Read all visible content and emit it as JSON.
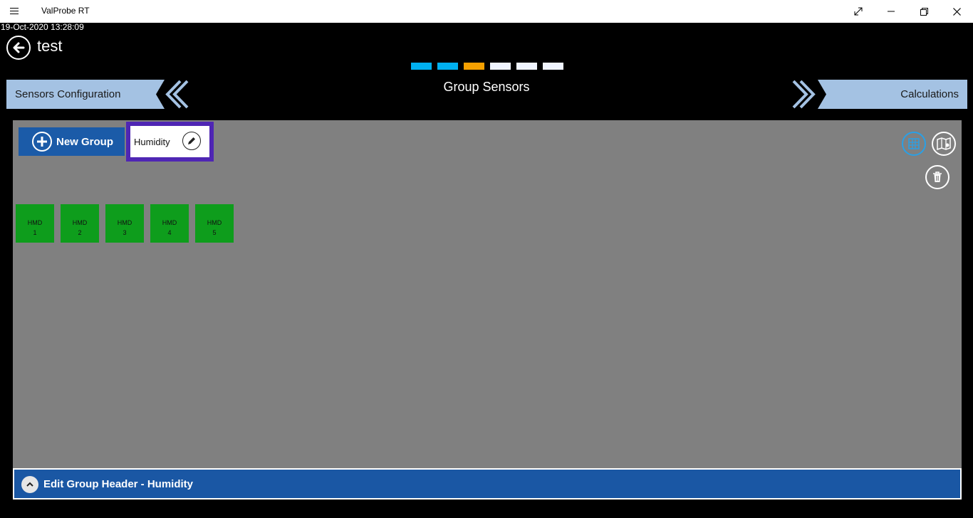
{
  "window": {
    "app_title": "ValProbe RT",
    "menu_icon": "hamburger-icon",
    "controls": [
      "expand-icon",
      "minimize-icon",
      "restore-icon",
      "close-icon"
    ]
  },
  "header": {
    "timestamp": "19-Oct-2020 13:28:09",
    "title": "test"
  },
  "wizard": {
    "steps": [
      {
        "color": "#00b0f0",
        "state": "done"
      },
      {
        "color": "#00b0f0",
        "state": "done"
      },
      {
        "color": "#f5a000",
        "state": "current"
      },
      {
        "color": "#f0f4ff",
        "state": "todo"
      },
      {
        "color": "#f0f4ff",
        "state": "todo"
      },
      {
        "color": "#f0f4ff",
        "state": "todo"
      }
    ],
    "prev_label": "Sensors Configuration",
    "next_label": "Calculations",
    "current_label": "Group Sensors"
  },
  "groups": {
    "new_group_label": "New Group",
    "tabs": [
      {
        "label": "Humidity",
        "selected": true
      }
    ]
  },
  "actions": {
    "icons": [
      "grid-icon",
      "map-icon",
      "trash-icon"
    ]
  },
  "sensors": [
    {
      "line1": "HMD",
      "line2": "1"
    },
    {
      "line1": "HMD",
      "line2": "2"
    },
    {
      "line1": "HMD",
      "line2": "3"
    },
    {
      "line1": "HMD",
      "line2": "4"
    },
    {
      "line1": "HMD",
      "line2": "5"
    }
  ],
  "footer": {
    "label": "Edit Group Header - Humidity"
  },
  "colors": {
    "accent_blue": "#1b5ba8",
    "sensor_green": "#0e9d1c",
    "selection_purple": "#4f26b4",
    "nav_light_blue": "#a4c2e3"
  }
}
